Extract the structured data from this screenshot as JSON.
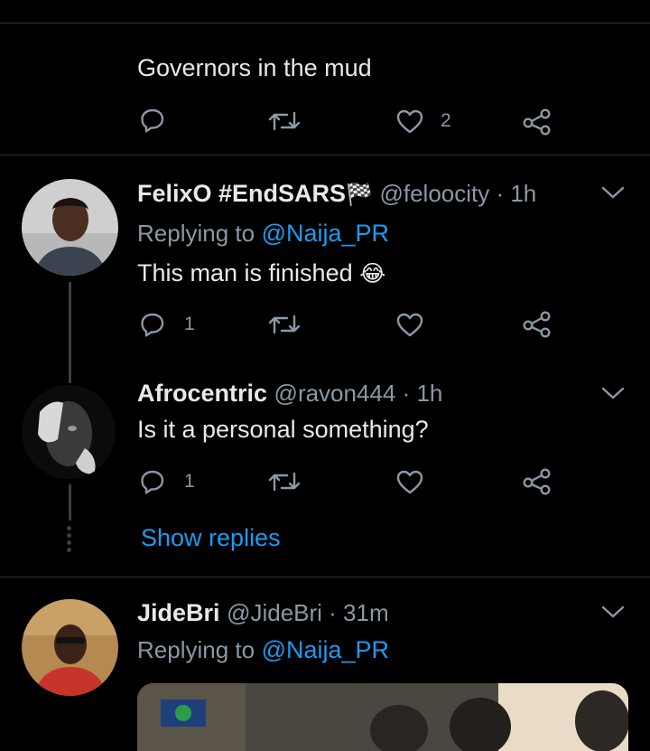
{
  "tweet0": {
    "text": "Governors in the mud",
    "likes": "2"
  },
  "tweet1": {
    "name": "FelixO #EndSARS",
    "flag": "🏁",
    "handle_time": "@feloocity · 1h",
    "replying_prefix": "Replying to",
    "replying_handle": "@Naija_PR",
    "text": "This man is finished",
    "emoji": "😂",
    "replies": "1"
  },
  "tweet2": {
    "name": "Afrocentric",
    "handle_time": "@ravon444 · 1h",
    "text": "Is it a personal something?",
    "replies": "1",
    "show_replies": "Show replies"
  },
  "tweet3": {
    "name": "JideBri",
    "handle_time": "@JideBri · 31m",
    "replying_prefix": "Replying to",
    "replying_handle": "@Naija_PR"
  },
  "colors": {
    "background": "#000000",
    "accent": "#1d9bf0",
    "muted": "#8b98a5",
    "text": "#e7e9ea",
    "divider": "#2f3336"
  },
  "icons": {
    "reply": "reply-icon",
    "retweet": "retweet-icon",
    "like": "like-icon",
    "share": "share-icon",
    "more": "chevron-down-icon"
  }
}
